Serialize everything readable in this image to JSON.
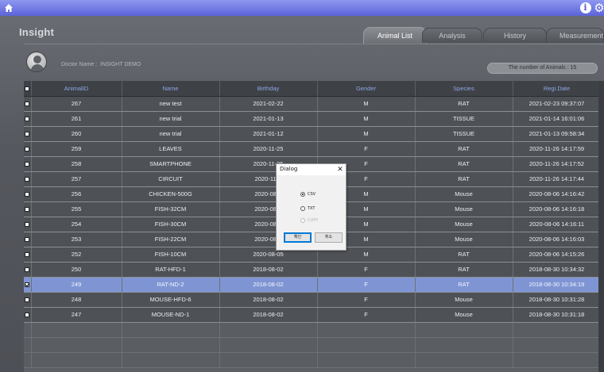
{
  "topbar": {
    "home_icon": "home-icon",
    "info_icon": "info-icon",
    "settings_icon": "gear-icon"
  },
  "app": {
    "title": "Insight"
  },
  "tabs": [
    {
      "label": "Animal List",
      "active": true
    },
    {
      "label": "Analysis",
      "active": false
    },
    {
      "label": "History",
      "active": false
    },
    {
      "label": "Measurement",
      "active": false
    }
  ],
  "doctor": {
    "label": "Doctor Name :",
    "name": "INSIGHT DEMO"
  },
  "count": {
    "text": "The number of Animals : 15"
  },
  "table": {
    "columns": [
      "AnimalID",
      "Name",
      "Birthday",
      "Gender",
      "Species",
      "Regi.Date"
    ],
    "rows": [
      {
        "checked": false,
        "selected": false,
        "cells": [
          "267",
          "new test",
          "2021-02-22",
          "M",
          "RAT",
          "2021-02-23 09:37:07"
        ]
      },
      {
        "checked": false,
        "selected": false,
        "cells": [
          "261",
          "new trial",
          "2021-01-13",
          "M",
          "TISSUE",
          "2021-01-14 16:01:06"
        ]
      },
      {
        "checked": false,
        "selected": false,
        "cells": [
          "260",
          "new trial",
          "2021-01-12",
          "M",
          "TISSUE",
          "2021-01-13 09:58:34"
        ]
      },
      {
        "checked": false,
        "selected": false,
        "cells": [
          "259",
          "LEAVES",
          "2020-11-25",
          "F",
          "RAT",
          "2020-11-26 14:17:59"
        ]
      },
      {
        "checked": false,
        "selected": false,
        "cells": [
          "258",
          "SMARTPHONE",
          "2020-11-25",
          "F",
          "RAT",
          "2020-11-26 14:17:52"
        ]
      },
      {
        "checked": false,
        "selected": false,
        "cells": [
          "257",
          "CIRCUIT",
          "2020-11-2",
          "F",
          "RAT",
          "2020-11-26 14:17:44"
        ]
      },
      {
        "checked": false,
        "selected": false,
        "cells": [
          "256",
          "CHICKEN-500G",
          "2020-08-0",
          "M",
          "Mouse",
          "2020-08-06 14:16:42"
        ]
      },
      {
        "checked": false,
        "selected": false,
        "cells": [
          "255",
          "FISH-32CM",
          "2020-08-0",
          "M",
          "Mouse",
          "2020-08-06 14:16:18"
        ]
      },
      {
        "checked": false,
        "selected": false,
        "cells": [
          "254",
          "FISH-30CM",
          "2020-08-0",
          "M",
          "Mouse",
          "2020-08-06 14:16:11"
        ]
      },
      {
        "checked": false,
        "selected": false,
        "cells": [
          "253",
          "FISH-22CM",
          "2020-08-0",
          "M",
          "Mouse",
          "2020-08-06 14:16:03"
        ]
      },
      {
        "checked": false,
        "selected": false,
        "cells": [
          "252",
          "FISH-10CM",
          "2020-08-05",
          "M",
          "RAT",
          "2020-08-06 14:15:26"
        ]
      },
      {
        "checked": false,
        "selected": false,
        "cells": [
          "250",
          "RAT-HFD-1",
          "2018-08-02",
          "F",
          "RAT",
          "2018-08-30 10:34:32"
        ]
      },
      {
        "checked": true,
        "selected": true,
        "cells": [
          "249",
          "RAT-ND-2",
          "2018-08-02",
          "F",
          "RAT",
          "2018-08-30 10:34:19"
        ]
      },
      {
        "checked": false,
        "selected": false,
        "cells": [
          "248",
          "MOUSE-HFD-6",
          "2018-08-02",
          "F",
          "Mouse",
          "2018-08-30 10:31:28"
        ]
      },
      {
        "checked": false,
        "selected": false,
        "cells": [
          "247",
          "MOUSE-ND-1",
          "2018-08-02",
          "F",
          "Mouse",
          "2018-08-30 10:31:18"
        ]
      }
    ],
    "empty_rows": 3
  },
  "dialog": {
    "title": "Dialog",
    "close_icon": "close-icon",
    "options": [
      {
        "label": "CSV",
        "selected": true,
        "enabled": true
      },
      {
        "label": "TXT",
        "selected": false,
        "enabled": true
      },
      {
        "label": "COPY",
        "selected": false,
        "enabled": false
      }
    ],
    "ok_label": "확인",
    "cancel_label": "취소"
  }
}
